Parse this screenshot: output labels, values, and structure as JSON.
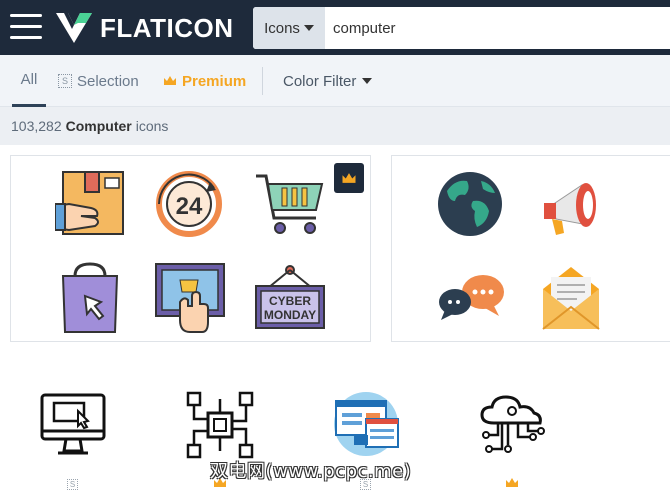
{
  "header": {
    "logo_text": "FLATICON",
    "search_type": "Icons",
    "search_value": "computer"
  },
  "filters": {
    "all": "All",
    "selection_badge": "S",
    "selection": "Selection",
    "premium": "Premium",
    "color_filter": "Color Filter"
  },
  "results": {
    "count": "103,282",
    "term": "Computer",
    "suffix": "icons"
  },
  "packs": [
    {
      "icons": [
        "delivery-box-hand",
        "24-hours",
        "shopping-cart",
        "shopping-bag-cursor",
        "online-shopping-tablet",
        "cyber-monday-sign"
      ],
      "premium": true
    },
    {
      "icons": [
        "globe",
        "megaphone",
        "chat-bubbles",
        "email-envelope"
      ],
      "premium": false
    }
  ],
  "icon_row": [
    {
      "name": "computer-monitor",
      "badge": "S"
    },
    {
      "name": "circuit-chip",
      "badge": "premium"
    },
    {
      "name": "computer-screens",
      "badge": "S"
    },
    {
      "name": "cloud-network",
      "badge": "premium"
    }
  ],
  "badge_letter": "S",
  "watermark": "双电网(www.pcpc.me)",
  "colors": {
    "topbar": "#1e2a3b",
    "premium": "#f5a623"
  }
}
